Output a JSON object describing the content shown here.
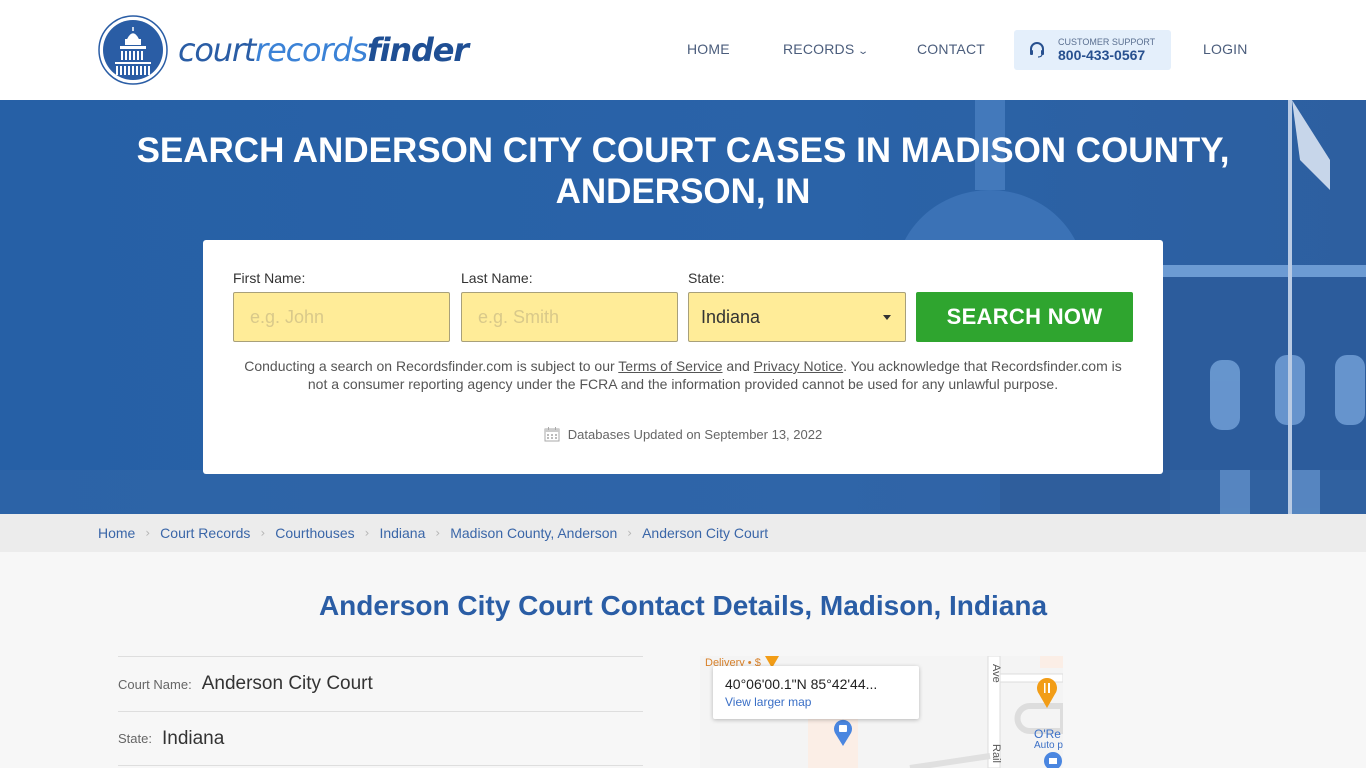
{
  "brand": {
    "name_part1": "court",
    "name_part2": "records",
    "name_part3": "finder",
    "primary_color": "#2660a6",
    "accent_green": "#2fa52f",
    "input_yellow": "#ffec98"
  },
  "nav": {
    "home": "HOME",
    "records": "RECORDS",
    "contact": "CONTACT",
    "support_label": "CUSTOMER SUPPORT",
    "support_phone": "800-433-0567",
    "login": "LOGIN"
  },
  "hero": {
    "title_line1": "SEARCH ANDERSON CITY COURT CASES IN MADISON COUNTY,",
    "title_line2": "ANDERSON, IN"
  },
  "search": {
    "first_name_label": "First Name:",
    "first_name_placeholder": "e.g. John",
    "first_name_value": "",
    "last_name_label": "Last Name:",
    "last_name_placeholder": "e.g. Smith",
    "last_name_value": "",
    "state_label": "State:",
    "state_value": "Indiana",
    "button_label": "SEARCH NOW",
    "disclaimer_before": "Conducting a search on Recordsfinder.com is subject to our ",
    "terms_link": "Terms of Service",
    "disclaimer_and": " and ",
    "privacy_link": "Privacy Notice",
    "disclaimer_after": ". You acknowledge that Recordsfinder.com is not a consumer reporting agency under the FCRA and the information provided cannot be used for any unlawful purpose.",
    "updated_text": "Databases Updated on September 13, 2022"
  },
  "breadcrumb": [
    {
      "label": "Home"
    },
    {
      "label": "Court Records"
    },
    {
      "label": "Courthouses"
    },
    {
      "label": "Indiana"
    },
    {
      "label": "Madison County, Anderson"
    },
    {
      "label": "Anderson City Court"
    }
  ],
  "main": {
    "title": "Anderson City Court Contact Details, Madison, Indiana",
    "details": [
      {
        "label": "Court Name:",
        "value": "Anderson City Court"
      },
      {
        "label": "State:",
        "value": "Indiana"
      }
    ]
  },
  "map": {
    "coords": "40°06'00.1\"N 85°42'44...",
    "larger_map": "View larger map",
    "labels": {
      "delivery": "Delivery • $",
      "ave": "Ave",
      "rail": "Rail",
      "oreilly": "O'Re",
      "auto": "Auto p"
    }
  }
}
